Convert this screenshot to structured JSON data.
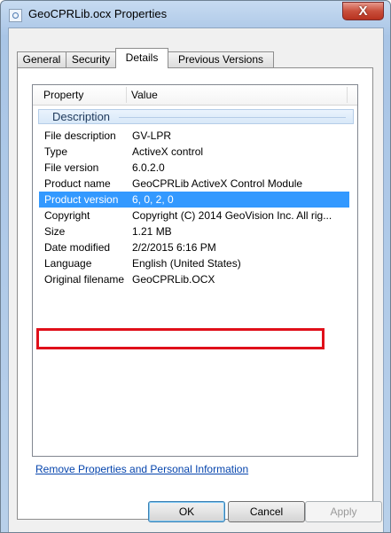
{
  "window": {
    "title": "GeoCPRLib.ocx Properties",
    "close_label": "X"
  },
  "tabs": [
    {
      "label": "General",
      "active": false
    },
    {
      "label": "Security",
      "active": false
    },
    {
      "label": "Details",
      "active": true
    },
    {
      "label": "Previous Versions",
      "active": false
    }
  ],
  "details": {
    "columns": {
      "property": "Property",
      "value": "Value"
    },
    "group_label": "Description",
    "rows": [
      {
        "property": "File description",
        "value": "GV-LPR"
      },
      {
        "property": "Type",
        "value": "ActiveX control"
      },
      {
        "property": "File version",
        "value": "6.0.2.0"
      },
      {
        "property": "Product name",
        "value": "GeoCPRLib ActiveX Control Module"
      },
      {
        "property": "Product version",
        "value": "6, 0, 2, 0",
        "selected": true
      },
      {
        "property": "Copyright",
        "value": "Copyright (C) 2014 GeoVision Inc. All rig..."
      },
      {
        "property": "Size",
        "value": "1.21 MB"
      },
      {
        "property": "Date modified",
        "value": "2/2/2015 6:16 PM"
      },
      {
        "property": "Language",
        "value": "English (United States)"
      },
      {
        "property": "Original filename",
        "value": "GeoCPRLib.OCX"
      }
    ]
  },
  "link": {
    "label": "Remove Properties and Personal Information"
  },
  "buttons": {
    "ok": "OK",
    "cancel": "Cancel",
    "apply": "Apply"
  },
  "colors": {
    "selection": "#3399ff",
    "highlight_outline": "#e0101a",
    "link": "#0645ad"
  }
}
